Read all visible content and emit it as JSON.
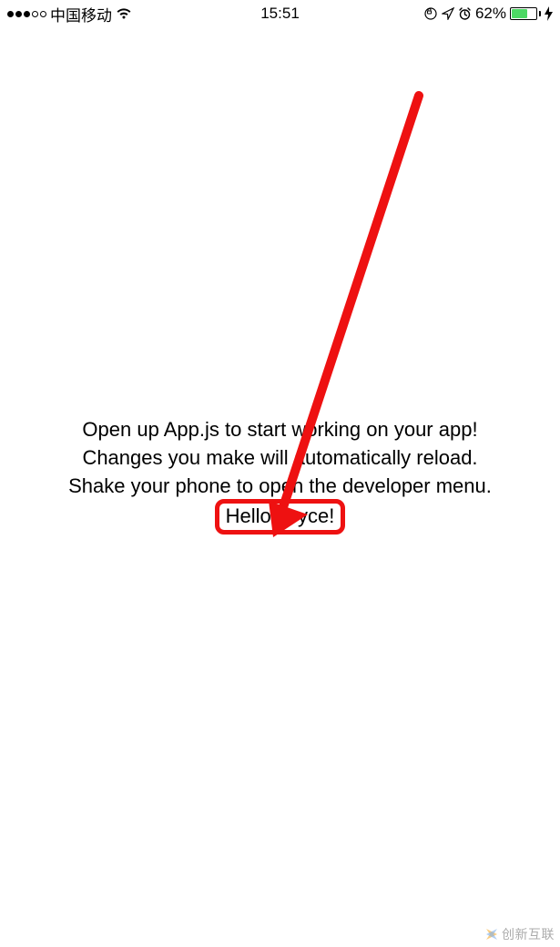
{
  "status_bar": {
    "carrier": "中国移动",
    "time": "15:51",
    "battery_percent": "62%"
  },
  "content": {
    "line1": "Open up App.js to start working on your app!",
    "line2": "Changes you make will automatically reload.",
    "line3": "Shake your phone to open the developer menu.",
    "hello": "Hello Joyce!"
  },
  "watermark": {
    "text": "创新互联"
  }
}
